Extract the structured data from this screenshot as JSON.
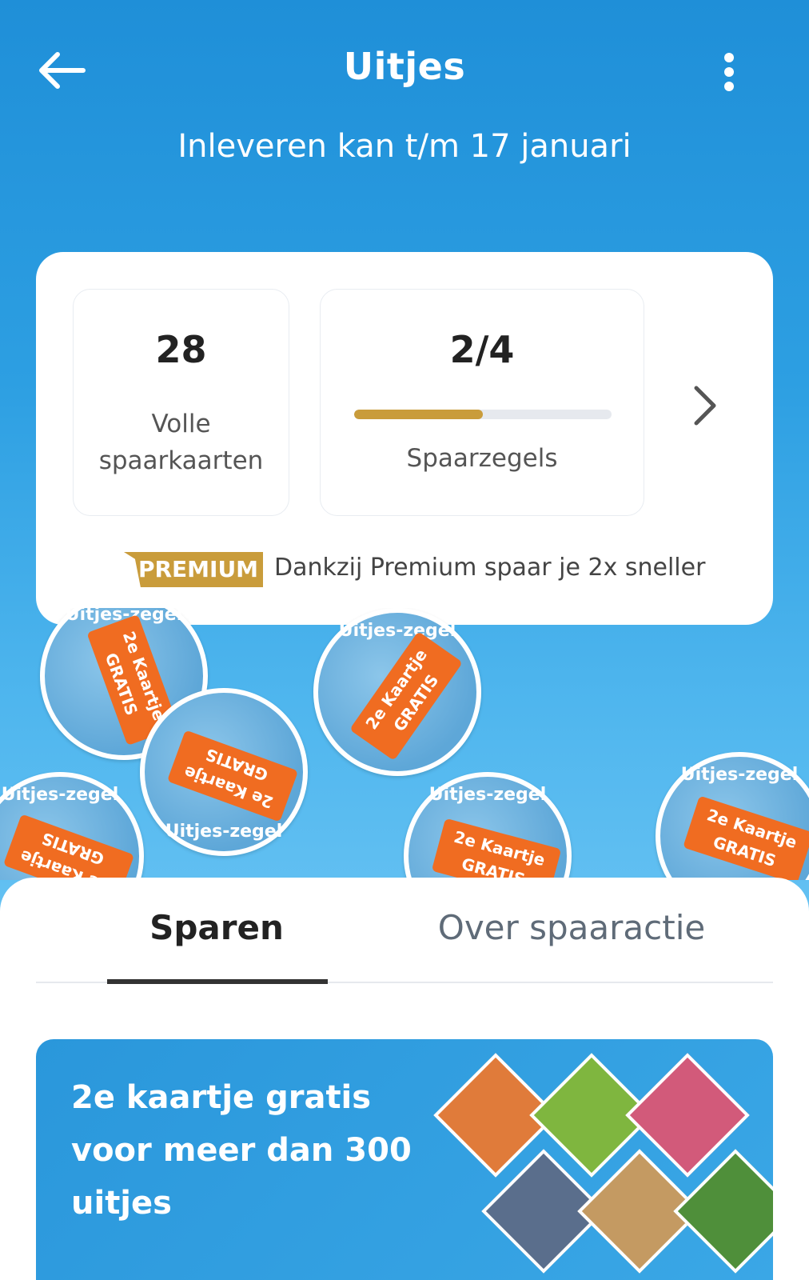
{
  "header": {
    "title": "Uitjes",
    "subtitle": "Inleveren kan t/m 17 januari"
  },
  "summary": {
    "full_cards_value": "28",
    "full_cards_label": "Volle spaarkaarten",
    "stamps_value": "2/4",
    "stamps_progress": 0.5,
    "stamps_label": "Spaarzegels",
    "premium_badge": "PREMIUM",
    "premium_text": "Dankzij Premium spaar je 2x sneller"
  },
  "stickers": {
    "ring_text": "Uitjes-zegel",
    "ticket_line1": "2e Kaartje",
    "ticket_line2": "GRATIS"
  },
  "tabs": [
    {
      "label": "Sparen",
      "active": true
    },
    {
      "label": "Over spaaractie",
      "active": false
    }
  ],
  "promo": {
    "text": "2e kaartje gratis voor meer dan 300 uitjes"
  },
  "colors": {
    "accent_gold": "#c99c3b",
    "ticket_orange": "#f06c21",
    "sky_blue": "#2a97db"
  }
}
